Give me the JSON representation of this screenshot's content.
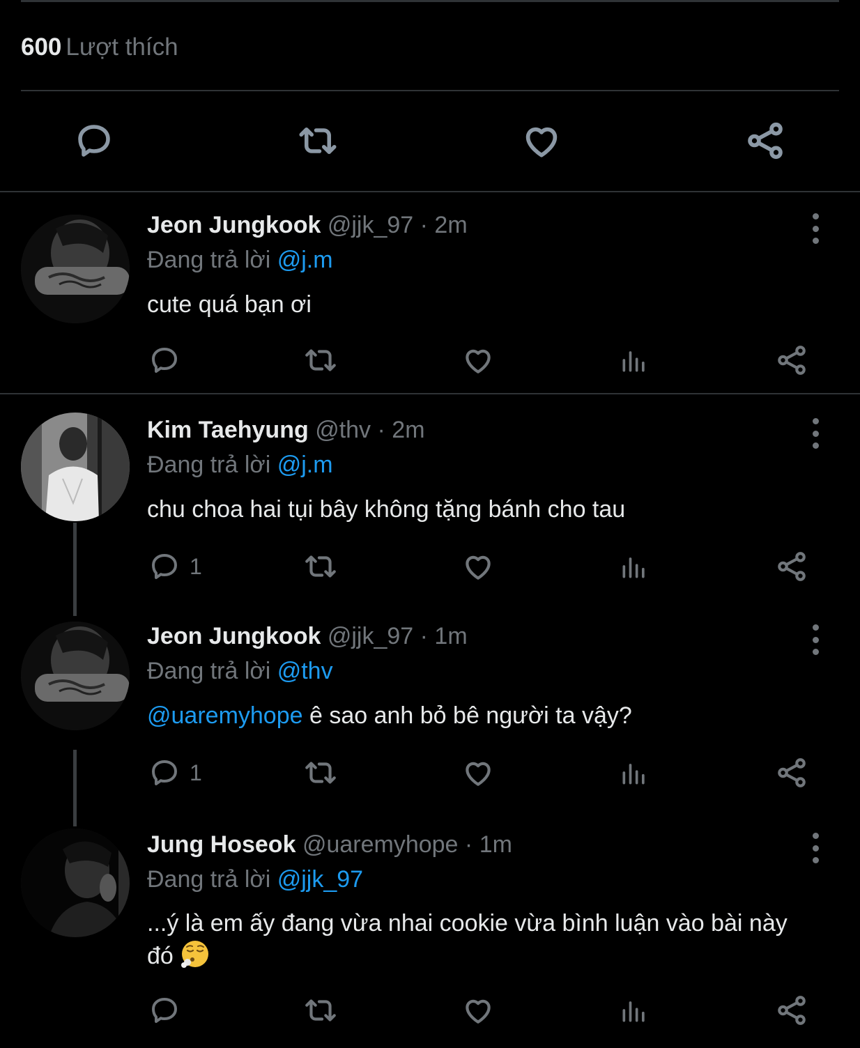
{
  "likes": {
    "count": "600",
    "label": "Lượt thích"
  },
  "main_actions": [
    {
      "name": "reply-icon"
    },
    {
      "name": "retweet-icon"
    },
    {
      "name": "like-icon"
    },
    {
      "name": "share-icon"
    }
  ],
  "replies": [
    {
      "name": "Jeon Jungkook",
      "handle": "@jjk_97",
      "sep": "·",
      "time": "2m",
      "replying_prefix": "Đang trả lời",
      "replying_to": "@j.m",
      "text_mention": "",
      "text": "cute quá bạn ơi",
      "reply_count": ""
    },
    {
      "name": "Kim Taehyung",
      "handle": "@thv",
      "sep": "·",
      "time": "2m",
      "replying_prefix": "Đang trả lời",
      "replying_to": "@j.m",
      "text_mention": "",
      "text": "chu choa hai tụi bây không tặng bánh cho tau",
      "reply_count": "1"
    },
    {
      "name": "Jeon Jungkook",
      "handle": "@jjk_97",
      "sep": "·",
      "time": "1m",
      "replying_prefix": "Đang trả lời",
      "replying_to": "@thv",
      "text_mention": "@uaremyhope",
      "text": " ê sao anh bỏ bê người ta vậy?",
      "reply_count": "1"
    },
    {
      "name": "Jung Hoseok",
      "handle": "@uaremyhope",
      "sep": "·",
      "time": "1m",
      "replying_prefix": "Đang trả lời",
      "replying_to": "@jjk_97",
      "text_mention": "",
      "text": "...ý là em ấy đang vừa nhai cookie vừa bình luận vào bài này đó ",
      "reply_count": ""
    }
  ],
  "colors": {
    "background": "#000000",
    "text": "#e7e9ea",
    "muted": "#71767b",
    "link": "#1d9bf0",
    "divider": "#2f3336"
  }
}
